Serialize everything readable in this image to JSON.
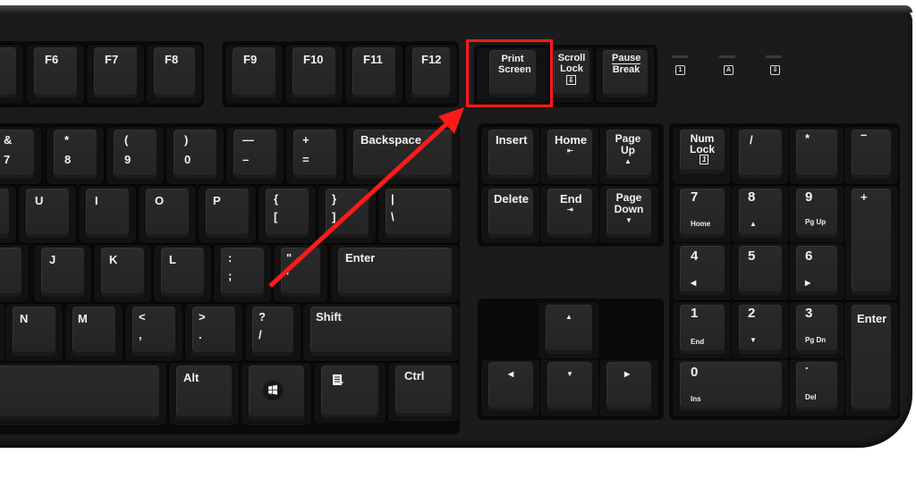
{
  "image": {
    "subject": "Black computer keyboard with Print Screen key highlighted",
    "annotation": {
      "highlight_key": "Print Screen",
      "highlight_color": "#ff1a1a",
      "arrow_color": "#ff1a1a"
    }
  },
  "function_row": {
    "keys": [
      "F6",
      "F7",
      "F8",
      "F9",
      "F10",
      "F11",
      "F12"
    ],
    "system_keys": {
      "print_screen": "Print\nScreen",
      "scroll_lock": "Scroll\nLock",
      "scroll_lock_icon": "⇩",
      "pause_break_top": "Pause",
      "pause_break_bottom": "Break"
    },
    "indicators": [
      "1",
      "A",
      "⇩"
    ]
  },
  "number_row": {
    "keys": [
      {
        "top": "&",
        "bottom": "7"
      },
      {
        "top": "*",
        "bottom": "8"
      },
      {
        "top": "(",
        "bottom": "9"
      },
      {
        "top": ")",
        "bottom": "0"
      },
      {
        "top": "—",
        "bottom": "–"
      },
      {
        "top": "+",
        "bottom": "="
      }
    ],
    "backspace": "Backspace"
  },
  "top_letter_row": {
    "keys": [
      "U",
      "I",
      "O",
      "P"
    ],
    "brackets": [
      {
        "top": "{",
        "bottom": "["
      },
      {
        "top": "}",
        "bottom": "]"
      }
    ],
    "pipe": {
      "top": "|",
      "bottom": "\\"
    }
  },
  "home_row": {
    "keys": [
      "J",
      "K",
      "L"
    ],
    "semicolon": {
      "top": ":",
      "bottom": ";"
    },
    "quote": {
      "top": "\"",
      "bottom": "'"
    },
    "enter": "Enter"
  },
  "bottom_letter_row": {
    "keys": [
      "N",
      "M"
    ],
    "punct": [
      {
        "top": "<",
        "bottom": ","
      },
      {
        "top": ">",
        "bottom": "."
      },
      {
        "top": "?",
        "bottom": "/"
      }
    ],
    "shift": "Shift"
  },
  "space_row": {
    "alt": "Alt",
    "windows_icon": "windows-logo",
    "menu_icon": "context-menu",
    "ctrl": "Ctrl"
  },
  "navigation": {
    "insert": "Insert",
    "home": "Home",
    "home_icon": "⇤",
    "page_up": "Page\nUp",
    "page_up_icon": "▲",
    "delete": "Delete",
    "end": "End",
    "end_icon": "⇥",
    "page_down": "Page\nDown",
    "page_down_icon": "▼"
  },
  "arrows": {
    "up": "▲",
    "left": "◀",
    "down": "▼",
    "right": "▶"
  },
  "numpad": {
    "num_lock": "Num\nLock",
    "num_lock_icon": "1",
    "divide": "/",
    "multiply": "*",
    "minus": "–",
    "plus": "+",
    "enter": "Enter",
    "keys": [
      {
        "main": "7",
        "sub": "Home"
      },
      {
        "main": "8",
        "sub": "▲"
      },
      {
        "main": "9",
        "sub": "Pg Up"
      },
      {
        "main": "4",
        "sub": "◀"
      },
      {
        "main": "5",
        "sub": ""
      },
      {
        "main": "6",
        "sub": "▶"
      },
      {
        "main": "1",
        "sub": "End"
      },
      {
        "main": "2",
        "sub": "▼"
      },
      {
        "main": "3",
        "sub": "Pg Dn"
      },
      {
        "main": "0",
        "sub": "Ins"
      },
      {
        "main": ".",
        "sub": "Del"
      }
    ]
  }
}
